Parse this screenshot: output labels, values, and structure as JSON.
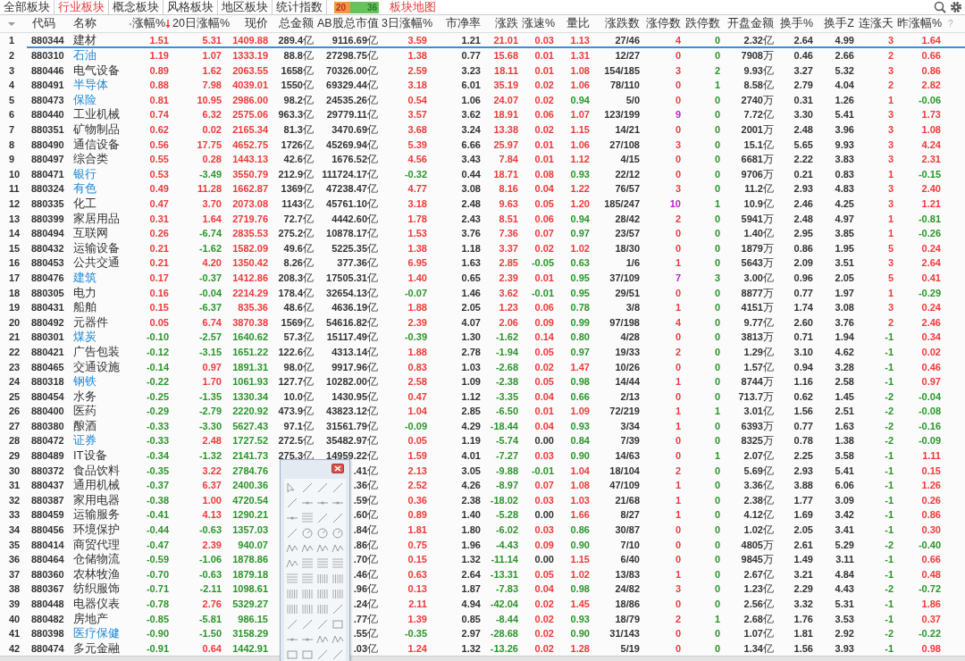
{
  "tabs": [
    {
      "label": "全部板块",
      "selected": false
    },
    {
      "label": "行业板块",
      "selected": true
    },
    {
      "label": "概念板块",
      "selected": false
    },
    {
      "label": "风格板块",
      "selected": false
    },
    {
      "label": "地区板块",
      "selected": false
    },
    {
      "label": "统计指数",
      "selected": false
    }
  ],
  "breadth": {
    "up": "20",
    "down": "36",
    "level": 0.36
  },
  "map_link": "板块地图",
  "columns": [
    {
      "label": "代码",
      "kind": "code"
    },
    {
      "label": "名称",
      "kind": "name"
    },
    {
      "label": "涨幅%",
      "kind": "sign",
      "sorted_descending": true
    },
    {
      "label": "20日涨幅%",
      "kind": "sign"
    },
    {
      "label": "现价",
      "kind": "price"
    },
    {
      "label": "总金额",
      "kind": "plain"
    },
    {
      "label": "AB股总市值",
      "kind": "plain"
    },
    {
      "label": "3日涨幅%",
      "kind": "sign"
    },
    {
      "label": "市净率",
      "kind": "plain"
    },
    {
      "label": "涨跌",
      "kind": "sign"
    },
    {
      "label": "涨速%",
      "kind": "sign"
    },
    {
      "label": "量比",
      "kind": "ratio"
    },
    {
      "label": "涨跌数",
      "kind": "plain"
    },
    {
      "label": "涨停数",
      "kind": "up_limit"
    },
    {
      "label": "跌停数",
      "kind": "down_limit"
    },
    {
      "label": "开盘金额",
      "kind": "plain"
    },
    {
      "label": "换手%",
      "kind": "plain"
    },
    {
      "label": "换手Z",
      "kind": "plain"
    },
    {
      "label": "连涨天",
      "kind": "sign"
    },
    {
      "label": "昨涨幅%",
      "kind": "sign"
    }
  ],
  "help_mark": "?",
  "rows": [
    {
      "no": "1",
      "code": "880344",
      "name": "建材",
      "highlight": false,
      "selected": true,
      "cells": [
        "1.51",
        "5.31",
        "1409.88",
        "289.4亿",
        "9116.69亿",
        "3.59",
        "1.21",
        "21.01",
        "0.03",
        "1.13",
        "27/46",
        "4",
        "0",
        "2.32亿",
        "2.64",
        "4.99",
        "3",
        "1.64"
      ]
    },
    {
      "no": "2",
      "code": "880310",
      "name": "石油",
      "highlight": true,
      "selected": false,
      "cells": [
        "1.19",
        "1.07",
        "1333.19",
        "88.8亿",
        "27298.75亿",
        "1.38",
        "0.77",
        "15.68",
        "0.01",
        "1.31",
        "12/27",
        "0",
        "0",
        "7908万",
        "0.46",
        "2.66",
        "2",
        "0.66"
      ]
    },
    {
      "no": "3",
      "code": "880446",
      "name": "电气设备",
      "highlight": false,
      "selected": false,
      "cells": [
        "0.89",
        "1.62",
        "2063.55",
        "1658亿",
        "70326.00亿",
        "2.59",
        "3.23",
        "18.11",
        "0.01",
        "1.08",
        "154/185",
        "3",
        "2",
        "9.93亿",
        "3.27",
        "5.32",
        "3",
        "0.86"
      ]
    },
    {
      "no": "4",
      "code": "880491",
      "name": "半导体",
      "highlight": true,
      "selected": false,
      "cells": [
        "0.88",
        "7.98",
        "4039.01",
        "1550亿",
        "69329.44亿",
        "3.18",
        "6.01",
        "35.19",
        "0.02",
        "1.06",
        "78/110",
        "0",
        "1",
        "8.58亿",
        "2.79",
        "4.04",
        "2",
        "2.82"
      ]
    },
    {
      "no": "5",
      "code": "880473",
      "name": "保险",
      "highlight": true,
      "selected": false,
      "cells": [
        "0.81",
        "10.95",
        "2986.00",
        "98.2亿",
        "24535.26亿",
        "0.54",
        "1.06",
        "24.07",
        "0.02",
        "0.94",
        "5/0",
        "0",
        "0",
        "2740万",
        "0.31",
        "1.26",
        "1",
        "-0.06"
      ]
    },
    {
      "no": "6",
      "code": "880440",
      "name": "工业机械",
      "highlight": false,
      "selected": false,
      "cells": [
        "0.74",
        "6.32",
        "2575.06",
        "963.3亿",
        "29779.11亿",
        "3.57",
        "3.62",
        "18.91",
        "0.06",
        "1.07",
        "123/199",
        "9",
        "0",
        "7.72亿",
        "3.30",
        "5.41",
        "3",
        "1.73"
      ]
    },
    {
      "no": "7",
      "code": "880351",
      "name": "矿物制品",
      "highlight": false,
      "selected": false,
      "cells": [
        "0.62",
        "0.02",
        "2165.34",
        "81.3亿",
        "3470.69亿",
        "3.68",
        "3.24",
        "13.38",
        "0.02",
        "1.15",
        "14/21",
        "0",
        "0",
        "2001万",
        "2.48",
        "3.96",
        "3",
        "1.08"
      ]
    },
    {
      "no": "8",
      "code": "880490",
      "name": "通信设备",
      "highlight": false,
      "selected": false,
      "cells": [
        "0.56",
        "17.75",
        "4652.75",
        "1726亿",
        "45269.94亿",
        "5.39",
        "6.66",
        "25.97",
        "0.01",
        "1.06",
        "27/108",
        "3",
        "0",
        "15.1亿",
        "5.65",
        "9.93",
        "3",
        "4.24"
      ]
    },
    {
      "no": "9",
      "code": "880497",
      "name": "综合类",
      "highlight": false,
      "selected": false,
      "cells": [
        "0.55",
        "0.28",
        "1443.13",
        "42.6亿",
        "1676.52亿",
        "4.56",
        "3.43",
        "7.84",
        "0.01",
        "1.12",
        "4/15",
        "0",
        "0",
        "6681万",
        "2.22",
        "3.83",
        "3",
        "2.31"
      ]
    },
    {
      "no": "10",
      "code": "880471",
      "name": "银行",
      "highlight": true,
      "selected": false,
      "cells": [
        "0.53",
        "-3.49",
        "3550.79",
        "212.9亿",
        "111724.17亿",
        "-0.32",
        "0.44",
        "18.71",
        "0.08",
        "0.93",
        "22/12",
        "0",
        "0",
        "9706万",
        "0.21",
        "0.83",
        "1",
        "-0.15"
      ]
    },
    {
      "no": "11",
      "code": "880324",
      "name": "有色",
      "highlight": true,
      "selected": false,
      "cells": [
        "0.49",
        "11.28",
        "1662.87",
        "1369亿",
        "47238.47亿",
        "4.77",
        "3.08",
        "8.16",
        "0.04",
        "1.22",
        "76/57",
        "3",
        "0",
        "11.2亿",
        "2.93",
        "4.83",
        "3",
        "2.40"
      ]
    },
    {
      "no": "12",
      "code": "880335",
      "name": "化工",
      "highlight": false,
      "selected": false,
      "cells": [
        "0.47",
        "3.70",
        "2073.08",
        "1143亿",
        "45761.10亿",
        "3.18",
        "2.48",
        "9.63",
        "0.05",
        "1.20",
        "185/247",
        "10",
        "1",
        "10.9亿",
        "2.46",
        "4.25",
        "3",
        "1.21"
      ]
    },
    {
      "no": "13",
      "code": "880399",
      "name": "家居用品",
      "highlight": false,
      "selected": false,
      "cells": [
        "0.31",
        "1.64",
        "2719.76",
        "72.7亿",
        "4442.60亿",
        "1.78",
        "2.43",
        "8.51",
        "0.06",
        "0.94",
        "28/42",
        "2",
        "0",
        "5941万",
        "2.48",
        "4.97",
        "1",
        "-0.81"
      ]
    },
    {
      "no": "14",
      "code": "880494",
      "name": "互联网",
      "highlight": false,
      "selected": false,
      "cells": [
        "0.26",
        "-6.74",
        "2835.53",
        "275.2亿",
        "10878.17亿",
        "1.53",
        "3.76",
        "7.36",
        "0.07",
        "0.97",
        "23/57",
        "0",
        "0",
        "1.40亿",
        "2.95",
        "3.85",
        "1",
        "-0.26"
      ]
    },
    {
      "no": "15",
      "code": "880432",
      "name": "运输设备",
      "highlight": false,
      "selected": false,
      "cells": [
        "0.21",
        "-1.62",
        "1582.09",
        "49.6亿",
        "5225.35亿",
        "1.38",
        "1.18",
        "3.37",
        "0.02",
        "1.02",
        "18/30",
        "0",
        "0",
        "1879万",
        "0.86",
        "1.95",
        "5",
        "0.24"
      ]
    },
    {
      "no": "16",
      "code": "880453",
      "name": "公共交通",
      "highlight": false,
      "selected": false,
      "cells": [
        "0.21",
        "4.20",
        "1350.42",
        "8.26亿",
        "377.36亿",
        "6.95",
        "1.63",
        "2.85",
        "-0.05",
        "0.63",
        "1/6",
        "1",
        "0",
        "5643万",
        "2.09",
        "3.51",
        "3",
        "2.64"
      ]
    },
    {
      "no": "17",
      "code": "880476",
      "name": "建筑",
      "highlight": true,
      "selected": false,
      "cells": [
        "0.17",
        "-0.37",
        "1412.86",
        "208.3亿",
        "17505.31亿",
        "1.40",
        "0.65",
        "2.39",
        "0.01",
        "0.95",
        "37/109",
        "7",
        "3",
        "3.00亿",
        "0.96",
        "2.05",
        "5",
        "0.41"
      ]
    },
    {
      "no": "18",
      "code": "880305",
      "name": "电力",
      "highlight": false,
      "selected": false,
      "cells": [
        "0.16",
        "-0.04",
        "2214.29",
        "178.4亿",
        "32654.13亿",
        "-0.07",
        "1.46",
        "3.62",
        "-0.01",
        "0.95",
        "29/51",
        "0",
        "0",
        "8877万",
        "0.77",
        "1.97",
        "1",
        "-0.29"
      ]
    },
    {
      "no": "19",
      "code": "880431",
      "name": "船舶",
      "highlight": false,
      "selected": false,
      "cells": [
        "0.15",
        "-6.37",
        "835.36",
        "48.6亿",
        "4636.19亿",
        "1.88",
        "2.05",
        "1.23",
        "0.06",
        "0.78",
        "3/8",
        "1",
        "0",
        "4151万",
        "1.74",
        "3.08",
        "3",
        "0.24"
      ]
    },
    {
      "no": "20",
      "code": "880492",
      "name": "元器件",
      "highlight": false,
      "selected": false,
      "cells": [
        "0.05",
        "6.74",
        "3870.38",
        "1569亿",
        "54616.82亿",
        "2.39",
        "4.07",
        "2.06",
        "0.09",
        "0.99",
        "97/198",
        "4",
        "0",
        "9.77亿",
        "2.60",
        "3.76",
        "2",
        "2.46"
      ]
    },
    {
      "no": "21",
      "code": "880301",
      "name": "煤炭",
      "highlight": true,
      "selected": false,
      "cells": [
        "-0.10",
        "-2.57",
        "1640.62",
        "57.3亿",
        "15117.49亿",
        "-0.39",
        "1.30",
        "-1.62",
        "0.14",
        "0.80",
        "4/28",
        "0",
        "0",
        "3813万",
        "0.71",
        "1.94",
        "-1",
        "0.34"
      ]
    },
    {
      "no": "22",
      "code": "880421",
      "name": "广告包装",
      "highlight": false,
      "selected": false,
      "cells": [
        "-0.12",
        "-3.15",
        "1651.22",
        "122.6亿",
        "4313.14亿",
        "1.88",
        "2.78",
        "-1.94",
        "0.05",
        "0.97",
        "19/33",
        "2",
        "0",
        "1.29亿",
        "3.10",
        "4.62",
        "-1",
        "0.02"
      ]
    },
    {
      "no": "23",
      "code": "880465",
      "name": "交通设施",
      "highlight": false,
      "selected": false,
      "cells": [
        "-0.14",
        "0.97",
        "1891.31",
        "98.0亿",
        "9917.96亿",
        "0.83",
        "1.03",
        "-2.68",
        "0.02",
        "1.47",
        "10/26",
        "0",
        "0",
        "1.57亿",
        "0.94",
        "3.28",
        "-1",
        "0.46"
      ]
    },
    {
      "no": "24",
      "code": "880318",
      "name": "钢铁",
      "highlight": true,
      "selected": false,
      "cells": [
        "-0.22",
        "1.70",
        "1061.93",
        "127.7亿",
        "10282.00亿",
        "2.58",
        "1.09",
        "-2.38",
        "0.05",
        "0.98",
        "14/44",
        "1",
        "0",
        "8744万",
        "1.16",
        "2.58",
        "-1",
        "0.97"
      ]
    },
    {
      "no": "25",
      "code": "880454",
      "name": "水务",
      "highlight": false,
      "selected": false,
      "cells": [
        "-0.25",
        "-1.35",
        "1330.34",
        "10.0亿",
        "1430.95亿",
        "0.47",
        "1.12",
        "-3.35",
        "0.04",
        "0.66",
        "2/13",
        "0",
        "0",
        "713.7万",
        "0.62",
        "1.45",
        "-2",
        "-0.04"
      ]
    },
    {
      "no": "26",
      "code": "880400",
      "name": "医药",
      "highlight": false,
      "selected": false,
      "cells": [
        "-0.29",
        "-2.79",
        "2220.92",
        "473.9亿",
        "43823.12亿",
        "1.04",
        "2.85",
        "-6.50",
        "0.01",
        "1.09",
        "72/219",
        "1",
        "1",
        "3.01亿",
        "1.56",
        "2.51",
        "-2",
        "-0.08"
      ]
    },
    {
      "no": "27",
      "code": "880380",
      "name": "酿酒",
      "highlight": false,
      "selected": false,
      "cells": [
        "-0.33",
        "-3.30",
        "5627.43",
        "97.1亿",
        "31561.79亿",
        "-0.09",
        "4.29",
        "-18.44",
        "0.04",
        "0.93",
        "3/34",
        "1",
        "0",
        "6393万",
        "0.77",
        "1.63",
        "-2",
        "-0.16"
      ]
    },
    {
      "no": "28",
      "code": "880472",
      "name": "证券",
      "highlight": true,
      "selected": false,
      "cells": [
        "-0.33",
        "2.48",
        "1727.52",
        "272.5亿",
        "35482.97亿",
        "0.05",
        "1.19",
        "-5.74",
        "0.00",
        "0.84",
        "7/39",
        "0",
        "0",
        "8325万",
        "0.78",
        "1.38",
        "-2",
        "-0.09"
      ]
    },
    {
      "no": "29",
      "code": "880489",
      "name": "IT设备",
      "highlight": false,
      "selected": false,
      "cells": [
        "-0.34",
        "-1.32",
        "2141.73",
        "275.3亿",
        "14959.22亿",
        "1.59",
        "4.01",
        "-7.27",
        "0.03",
        "0.90",
        "14/63",
        "0",
        "1",
        "2.07亿",
        "2.25",
        "3.58",
        "-1",
        "1.11"
      ]
    },
    {
      "no": "30",
      "code": "880372",
      "name": "食品饮料",
      "highlight": false,
      "selected": false,
      "cells": [
        "-0.35",
        "3.22",
        "2784.76",
        null,
        ".41亿",
        "2.13",
        "3.05",
        "-9.88",
        "-0.01",
        "1.04",
        "18/104",
        "2",
        "0",
        "5.69亿",
        "2.93",
        "5.41",
        "-1",
        "0.15"
      ]
    },
    {
      "no": "31",
      "code": "880437",
      "name": "通用机械",
      "highlight": false,
      "selected": false,
      "cells": [
        "-0.37",
        "6.37",
        "2400.36",
        null,
        ".36亿",
        "2.52",
        "4.26",
        "-8.97",
        "0.07",
        "1.08",
        "47/109",
        "1",
        "0",
        "3.36亿",
        "3.88",
        "6.06",
        "-1",
        "1.26"
      ]
    },
    {
      "no": "32",
      "code": "880387",
      "name": "家用电器",
      "highlight": false,
      "selected": false,
      "cells": [
        "-0.38",
        "1.00",
        "4720.54",
        null,
        ".59亿",
        "0.36",
        "2.38",
        "-18.02",
        "0.03",
        "1.03",
        "21/68",
        "1",
        "0",
        "2.38亿",
        "1.77",
        "3.09",
        "-1",
        "0.26"
      ]
    },
    {
      "no": "33",
      "code": "880459",
      "name": "运输服务",
      "highlight": false,
      "selected": false,
      "cells": [
        "-0.41",
        "4.13",
        "1290.21",
        null,
        ".60亿",
        "0.89",
        "1.40",
        "-5.28",
        "0.00",
        "1.66",
        "8/27",
        "1",
        "0",
        "4.12亿",
        "1.69",
        "3.42",
        "-1",
        "0.86"
      ]
    },
    {
      "no": "34",
      "code": "880456",
      "name": "环境保护",
      "highlight": false,
      "selected": false,
      "cells": [
        "-0.44",
        "-0.63",
        "1357.03",
        null,
        ".84亿",
        "1.81",
        "1.80",
        "-6.02",
        "0.03",
        "0.86",
        "30/87",
        "0",
        "0",
        "1.02亿",
        "2.05",
        "3.41",
        "-1",
        "0.30"
      ]
    },
    {
      "no": "35",
      "code": "880414",
      "name": "商贸代理",
      "highlight": false,
      "selected": false,
      "cells": [
        "-0.47",
        "2.39",
        "940.07",
        null,
        ".86亿",
        "0.75",
        "1.96",
        "-4.43",
        "0.09",
        "0.90",
        "7/10",
        "0",
        "0",
        "4805万",
        "2.61",
        "5.29",
        "-2",
        "-0.40"
      ]
    },
    {
      "no": "36",
      "code": "880464",
      "name": "仓储物流",
      "highlight": false,
      "selected": false,
      "cells": [
        "-0.59",
        "-1.06",
        "1878.86",
        null,
        ".70亿",
        "0.15",
        "1.32",
        "-11.14",
        "0.00",
        "1.15",
        "6/40",
        "0",
        "0",
        "9845万",
        "1.49",
        "3.11",
        "-1",
        "0.66"
      ]
    },
    {
      "no": "37",
      "code": "880360",
      "name": "农林牧渔",
      "highlight": false,
      "selected": false,
      "cells": [
        "-0.70",
        "-0.63",
        "1879.18",
        null,
        ".46亿",
        "0.63",
        "2.64",
        "-13.31",
        "0.05",
        "1.02",
        "13/83",
        "1",
        "0",
        "2.67亿",
        "3.21",
        "4.84",
        "-1",
        "0.48"
      ]
    },
    {
      "no": "38",
      "code": "880367",
      "name": "纺织服饰",
      "highlight": false,
      "selected": false,
      "cells": [
        "-0.71",
        "-2.11",
        "1098.61",
        null,
        ".96亿",
        "0.13",
        "1.87",
        "-7.83",
        "0.04",
        "0.98",
        "24/82",
        "3",
        "0",
        "1.23亿",
        "2.29",
        "4.43",
        "-2",
        "-0.72"
      ]
    },
    {
      "no": "39",
      "code": "880448",
      "name": "电器仪表",
      "highlight": false,
      "selected": false,
      "cells": [
        "-0.78",
        "2.76",
        "5329.27",
        null,
        ".24亿",
        "2.11",
        "4.94",
        "-42.04",
        "0.02",
        "1.45",
        "18/86",
        "0",
        "0",
        "2.56亿",
        "3.32",
        "5.31",
        "-1",
        "1.86"
      ]
    },
    {
      "no": "40",
      "code": "880482",
      "name": "房地产",
      "highlight": false,
      "selected": false,
      "cells": [
        "-0.85",
        "-5.81",
        "986.15",
        null,
        ".77亿",
        "1.39",
        "0.85",
        "-8.44",
        "0.02",
        "0.93",
        "18/79",
        "2",
        "1",
        "2.68亿",
        "1.76",
        "3.53",
        "-1",
        "0.37"
      ]
    },
    {
      "no": "41",
      "code": "880398",
      "name": "医疗保健",
      "highlight": true,
      "selected": false,
      "cells": [
        "-0.90",
        "-1.50",
        "3158.29",
        null,
        ".55亿",
        "-0.35",
        "2.97",
        "-28.68",
        "0.02",
        "0.90",
        "31/143",
        "0",
        "0",
        "1.07亿",
        "1.81",
        "2.92",
        "-2",
        "-0.22"
      ]
    },
    {
      "no": "42",
      "code": "880474",
      "name": "多元金融",
      "highlight": false,
      "selected": false,
      "cells": [
        "-0.91",
        "0.64",
        "1442.91",
        null,
        ".03亿",
        "1.24",
        "1.32",
        "-13.26",
        "0.02",
        "1.28",
        "5/19",
        "0",
        "0",
        "1.34亿",
        "1.56",
        "3.93",
        "-1",
        "0.98"
      ]
    }
  ]
}
